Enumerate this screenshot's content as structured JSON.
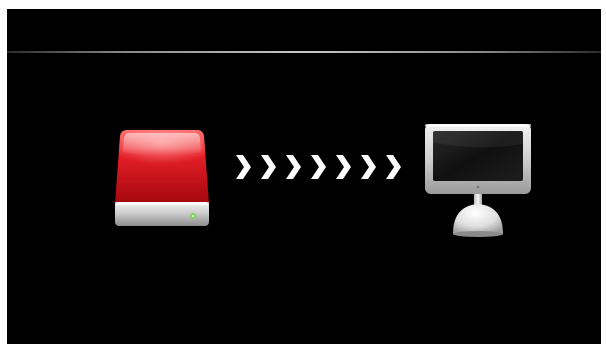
{
  "screen": {
    "background": "#000000",
    "transfer": {
      "source_icon": "external-hard-drive-icon",
      "source_color": "#d8161f",
      "direction_icon": "chevron-right-icon",
      "direction_count": 7,
      "target_icon": "imac-monitor-icon",
      "target_color": "#e6e6e6"
    }
  }
}
